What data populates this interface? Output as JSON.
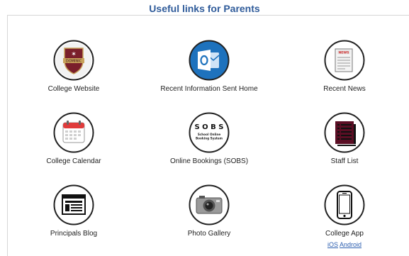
{
  "header": {
    "title": "Useful links for Parents"
  },
  "tiles": {
    "college_website": {
      "label": "College Website",
      "icon": "college-crest-icon"
    },
    "recent_info": {
      "label": "Recent Information Sent Home",
      "icon": "outlook-icon"
    },
    "recent_news": {
      "label": "Recent News",
      "icon": "newspaper-icon"
    },
    "calendar": {
      "label": "College Calendar",
      "icon": "calendar-icon"
    },
    "sobs": {
      "label": "Online Bookings (SOBS)",
      "icon": "sobs-icon",
      "badge_title": "S O B S",
      "badge_sub1": "School Online",
      "badge_sub2": "Booking System"
    },
    "staff_list": {
      "label": "Staff List",
      "icon": "staff-list-icon"
    },
    "blog": {
      "label": "Principals Blog",
      "icon": "browser-window-icon"
    },
    "photos": {
      "label": "Photo Gallery",
      "icon": "camera-icon"
    },
    "app": {
      "label": "College App",
      "icon": "smartphone-icon",
      "ios_link": "iOS",
      "android_link": "Android"
    }
  },
  "icon_texts": {
    "crest_text": "DOMINIC",
    "news_text": "NEWS"
  },
  "colors": {
    "title": "#2f5b9a",
    "link": "#2d5fb0",
    "outlook_blue": "#1e72bd",
    "crest_maroon": "#7a1f2b",
    "calendar_red": "#e03b3b",
    "staff_maroon": "#5a0e24"
  }
}
